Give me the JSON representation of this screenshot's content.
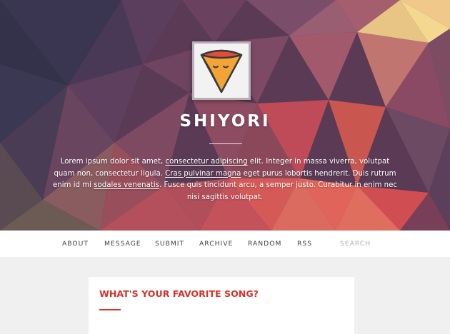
{
  "header": {
    "blog_title": "SHIYORI",
    "description": {
      "p1": "Lorem ipsum dolor sit amet, ",
      "link1": "consectetur adipiscing",
      "p2": " elit. Integer in massa viverra, volutpat quam non, consectetur ligula. ",
      "link2": "Cras pulvinar magna",
      "p3": " eget purus lobortis hendrerit. Duis rutrum enim id mi ",
      "link3": "sodales venenatis",
      "p4": ". Fusce quis tincidunt arcu, a semper justo. Curabitur in enim nec nisi sagittis volutpat."
    },
    "avatar_icon": "pizza-slice-icon"
  },
  "nav": {
    "items": [
      {
        "label": "ABOUT"
      },
      {
        "label": "MESSAGE"
      },
      {
        "label": "SUBMIT"
      },
      {
        "label": "ARCHIVE"
      },
      {
        "label": "RANDOM"
      },
      {
        "label": "RSS"
      }
    ],
    "search_placeholder": "SEARCH"
  },
  "post": {
    "title": "WHAT'S YOUR FAVORITE SONG?"
  },
  "colors": {
    "accent": "#d9312b",
    "page_background": "#f0f0f0"
  }
}
